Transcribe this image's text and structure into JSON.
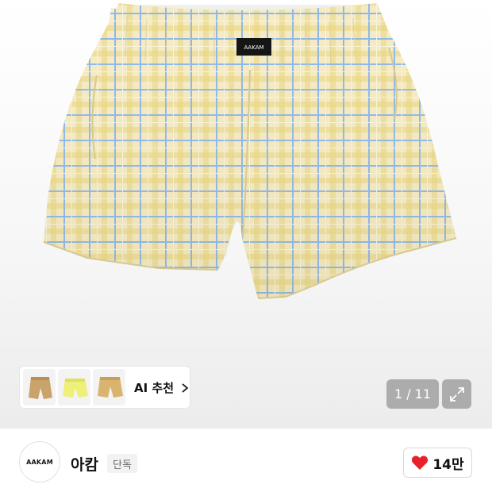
{
  "product": {
    "image_alt": "yellow-blue-check-shorts",
    "waist_tag_label": "AAKAM",
    "page_counter": "1 / 11"
  },
  "ai_recommend": {
    "label": "AI 추천",
    "thumbnails": [
      "tan-shorts",
      "yellow-shorts",
      "beige-shorts"
    ]
  },
  "brand": {
    "logo_text": "AAKAM",
    "name": "아캄",
    "badge": "단독"
  },
  "like": {
    "count": "14만",
    "heart_color": "#e8202a"
  },
  "colors": {
    "plaid_base": "#f4ebc4",
    "plaid_blue": "#8fb8e8",
    "plaid_yellow": "#e9d47e"
  }
}
